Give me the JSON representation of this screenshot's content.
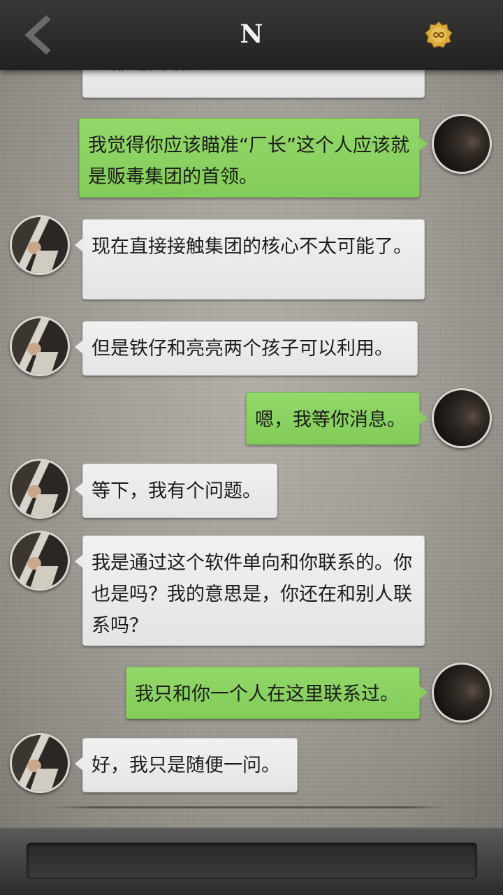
{
  "header": {
    "title": "N",
    "back_icon": "chevron-left-icon",
    "menu_icon": "infinity-badge-icon",
    "badge_color": "#d9a93a"
  },
  "chat": {
    "cut_off_message": "人都是突破口。",
    "messages": [
      {
        "from": "me",
        "text": "我觉得你应该瞄准“厂长”这个人应该就是贩毒集团的首领。"
      },
      {
        "from": "other",
        "text": "现在直接接触集团的核心不太可能了。"
      },
      {
        "from": "other",
        "text": "但是铁仔和亮亮两个孩子可以利用。"
      },
      {
        "from": "me",
        "text": "嗯，我等你消息。"
      },
      {
        "from": "other",
        "text": "等下，我有个问题。"
      },
      {
        "from": "other",
        "text": "我是通过这个软件单向和你联系的。你也是吗？我的意思是，你还在和别人联系吗？"
      },
      {
        "from": "me",
        "text": "我只和你一个人在这里联系过。"
      },
      {
        "from": "other",
        "text": "好，我只是随便一问。"
      }
    ],
    "colors": {
      "outgoing": "#8bd262",
      "incoming": "#ececec"
    }
  },
  "input": {
    "placeholder": ""
  }
}
